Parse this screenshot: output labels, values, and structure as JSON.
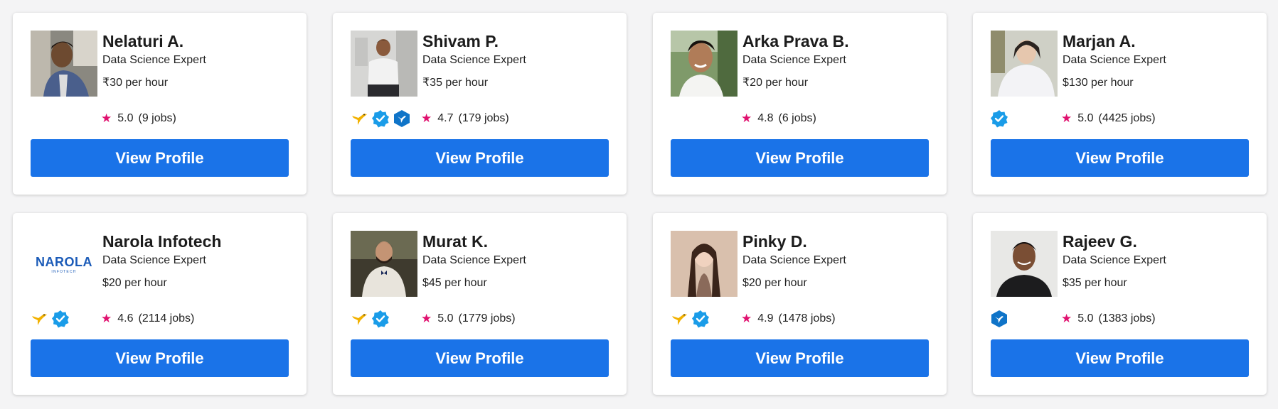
{
  "cards": [
    {
      "name": "Nelaturi A.",
      "subtitle": "Data Science Expert",
      "rate": "₹30 per hour",
      "rating": "5.0",
      "jobs": "(9 jobs)",
      "button": "View Profile",
      "badges": []
    },
    {
      "name": "Shivam P.",
      "subtitle": "Data Science Expert",
      "rate": "₹35 per hour",
      "rating": "4.7",
      "jobs": "(179 jobs)",
      "button": "View Profile",
      "badges": [
        "hummingbird-icon",
        "verified-icon",
        "preferred-shield-icon"
      ]
    },
    {
      "name": "Arka Prava B.",
      "subtitle": "Data Science Expert",
      "rate": "₹20 per hour",
      "rating": "4.8",
      "jobs": "(6 jobs)",
      "button": "View Profile",
      "badges": []
    },
    {
      "name": "Marjan A.",
      "subtitle": "Data Science Expert",
      "rate": "$130 per hour",
      "rating": "5.0",
      "jobs": "(4425 jobs)",
      "button": "View Profile",
      "badges": [
        "verified-icon"
      ]
    },
    {
      "name": "Narola Infotech",
      "subtitle": "Data Science Expert",
      "rate": "$20 per hour",
      "rating": "4.6",
      "jobs": "(2114 jobs)",
      "button": "View Profile",
      "badges": [
        "hummingbird-icon",
        "verified-icon"
      ],
      "logo": {
        "main": "NAROLA",
        "sub": "INFOTECH"
      }
    },
    {
      "name": "Murat K.",
      "subtitle": "Data Science Expert",
      "rate": "$45 per hour",
      "rating": "5.0",
      "jobs": "(1779 jobs)",
      "button": "View Profile",
      "badges": [
        "hummingbird-icon",
        "verified-icon"
      ]
    },
    {
      "name": "Pinky D.",
      "subtitle": "Data Science Expert",
      "rate": "$20 per hour",
      "rating": "4.9",
      "jobs": "(1478 jobs)",
      "button": "View Profile",
      "badges": [
        "hummingbird-icon",
        "verified-icon"
      ]
    },
    {
      "name": "Rajeev G.",
      "subtitle": "Data Science Expert",
      "rate": "$35 per hour",
      "rating": "5.0",
      "jobs": "(1383 jobs)",
      "button": "View Profile",
      "badges": [
        "preferred-shield-icon"
      ]
    }
  ],
  "colors": {
    "accent": "#1a73e8",
    "star": "#e0116f",
    "badge_blue": "#1a9ce8",
    "badge_gold": "#f2b100",
    "shield_blue": "#0f74c8"
  },
  "star_glyph": "★"
}
